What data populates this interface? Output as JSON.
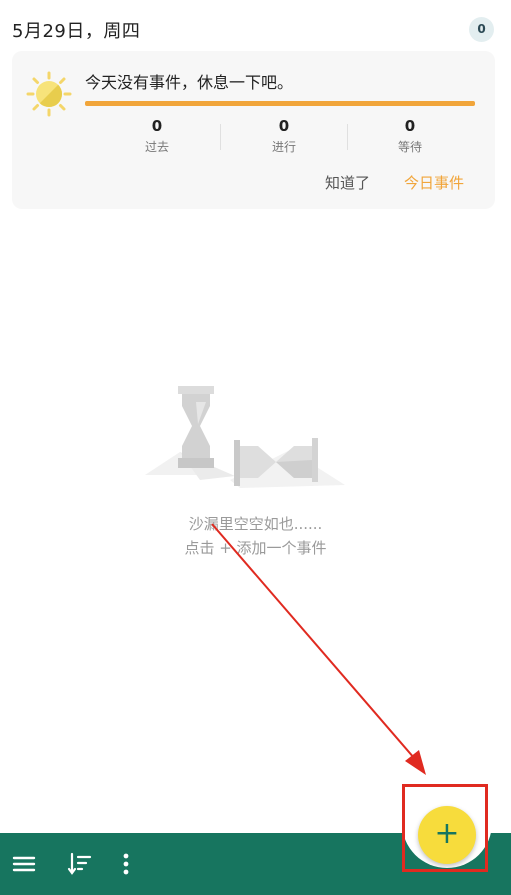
{
  "header": {
    "date": "5月29日，周四",
    "count_badge": "0"
  },
  "today_card": {
    "message": "今天没有事件，休息一下吧。",
    "progress": 1.0,
    "stats": [
      {
        "value": "0",
        "label": "过去"
      },
      {
        "value": "0",
        "label": "进行"
      },
      {
        "value": "0",
        "label": "等待"
      }
    ],
    "dismiss_label": "知道了",
    "today_events_label": "今日事件",
    "accent_color": "#f1a53a"
  },
  "empty_state": {
    "line1": "沙漏里空空如也......",
    "line2": "点击 + 添加一个事件",
    "icon": "hourglass-illustration"
  },
  "bottom_bar": {
    "color": "#17755f",
    "icons": [
      "menu-icon",
      "sort-icon",
      "more-vert-icon"
    ],
    "fab_label": "+",
    "fab_color": "#f7dc3c"
  },
  "annotation": {
    "color": "#e02a20"
  }
}
